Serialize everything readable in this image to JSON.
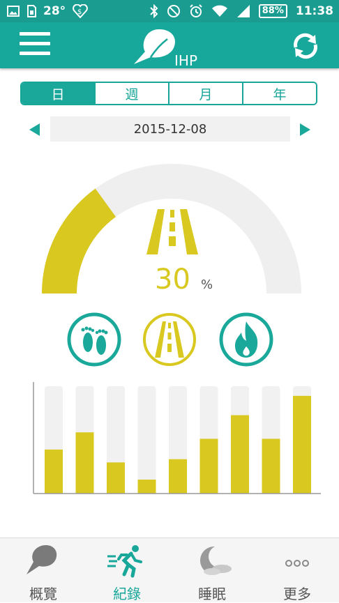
{
  "status_bar": {
    "temperature": "28°",
    "battery": "88%",
    "time": "11:38"
  },
  "app_bar": {
    "logo_text": "IHP",
    "icons": [
      "menu-icon",
      "sync-icon"
    ]
  },
  "period_tabs": [
    {
      "label": "日",
      "active": true
    },
    {
      "label": "週",
      "active": false
    },
    {
      "label": "月",
      "active": false
    },
    {
      "label": "年",
      "active": false
    }
  ],
  "date_nav": {
    "date": "2015-12-08"
  },
  "gauge": {
    "value": 30,
    "percent_text": "30",
    "unit": "%",
    "fill_color": "#d8c81f",
    "track_color": "#efefef"
  },
  "category_icons": [
    {
      "name": "steps-icon",
      "color": "#1aa89b",
      "active": false
    },
    {
      "name": "distance-icon",
      "color": "#d8c81f",
      "active": true
    },
    {
      "name": "calories-icon",
      "color": "#1aa89b",
      "active": false
    }
  ],
  "chart_data": {
    "type": "bar",
    "values": [
      0.41,
      0.57,
      0.29,
      0.13,
      0.32,
      0.51,
      0.73,
      0.51,
      0.91
    ],
    "max": 1.0,
    "bar_color": "#d8c81f",
    "track_color": "#f1f1f1"
  },
  "bottom_nav": [
    {
      "label": "概覽",
      "icon": "overview-icon",
      "active": false
    },
    {
      "label": "紀錄",
      "icon": "running-icon",
      "active": true
    },
    {
      "label": "睡眠",
      "icon": "sleep-moon-icon",
      "active": false
    },
    {
      "label": "更多",
      "icon": "more-dots-icon",
      "active": false
    }
  ],
  "colors": {
    "primary": "#1aa89b",
    "accent": "#d8c81f"
  }
}
